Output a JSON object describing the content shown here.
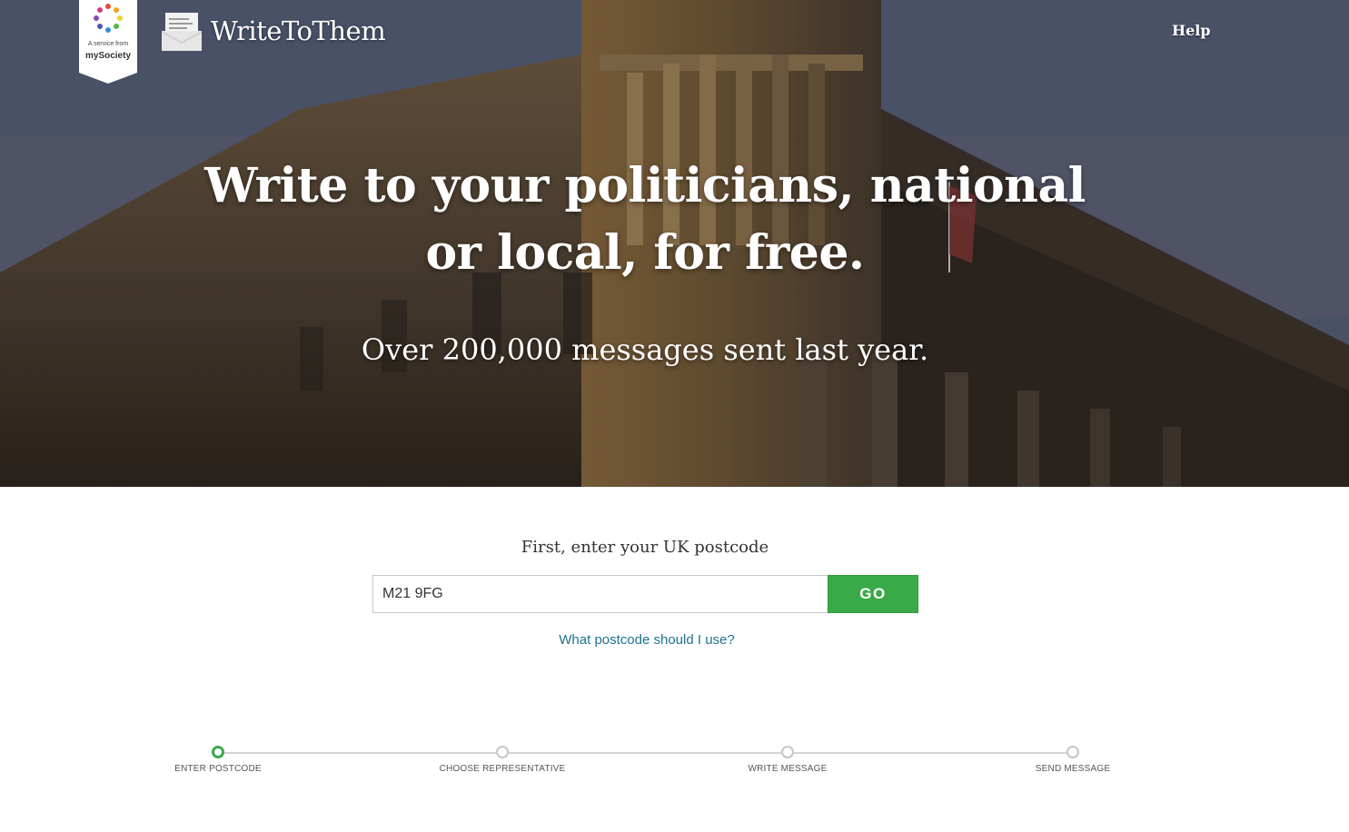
{
  "brand": {
    "badge_small": "A service from",
    "badge_name": "mySociety",
    "site_name": "WriteToThem"
  },
  "nav": {
    "help_label": "Help"
  },
  "hero": {
    "headline": "Write to your politicians, national or local, for free.",
    "subheadline": "Over 200,000 messages sent last year."
  },
  "form": {
    "label": "First, enter your UK postcode",
    "postcode_value": "M21 9FG",
    "go_label": "GO",
    "help_link": "What postcode should I use?"
  },
  "steps": [
    {
      "label": "Enter postcode",
      "active": true
    },
    {
      "label": "Choose representative",
      "active": false
    },
    {
      "label": "Write message",
      "active": false
    },
    {
      "label": "Send message",
      "active": false
    }
  ],
  "colors": {
    "accent_green": "#3aaa48",
    "link_blue": "#1f7290"
  }
}
